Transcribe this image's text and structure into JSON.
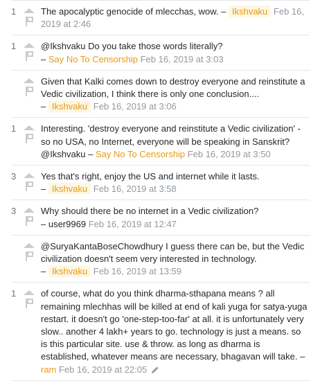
{
  "comments": [
    {
      "score": "1",
      "segments": [
        {
          "type": "text",
          "value": "The apocalyptic genocide of mlecchas, wow. – "
        },
        {
          "type": "user",
          "value": "Ikshvaku",
          "style": "owner"
        },
        {
          "type": "text",
          "value": " "
        },
        {
          "type": "date",
          "value": "Feb 16, 2019 at 2:46"
        }
      ]
    },
    {
      "score": "1",
      "segments": [
        {
          "type": "text",
          "value": "@Ikshvaku Do you take those words literally?"
        },
        {
          "type": "br"
        },
        {
          "type": "text",
          "value": "– "
        },
        {
          "type": "user",
          "value": "Say No To Censorship",
          "style": "orange"
        },
        {
          "type": "text",
          "value": " "
        },
        {
          "type": "date",
          "value": "Feb 16, 2019 at 3:03"
        }
      ]
    },
    {
      "score": "",
      "segments": [
        {
          "type": "text",
          "value": "Given that Kalki comes down to destroy everyone and reinstitute a Vedic civilization, I think there is only one conclusion...."
        },
        {
          "type": "br"
        },
        {
          "type": "text",
          "value": "– "
        },
        {
          "type": "user",
          "value": "Ikshvaku",
          "style": "owner"
        },
        {
          "type": "text",
          "value": " "
        },
        {
          "type": "date",
          "value": "Feb 16, 2019 at 3:06"
        }
      ]
    },
    {
      "score": "1",
      "segments": [
        {
          "type": "text",
          "value": "Interesting. 'destroy everyone and reinstitute a Vedic civilization' - so no USA, no Internet, everyone will be speaking in Sanskrit? @Ikshvaku – "
        },
        {
          "type": "user",
          "value": "Say No To Censorship",
          "style": "orange"
        },
        {
          "type": "text",
          "value": " "
        },
        {
          "type": "date",
          "value": "Feb 16, 2019 at 3:50"
        }
      ]
    },
    {
      "score": "3",
      "segments": [
        {
          "type": "text",
          "value": "Yes that's right, enjoy the US and internet while it lasts."
        },
        {
          "type": "br"
        },
        {
          "type": "text",
          "value": "– "
        },
        {
          "type": "user",
          "value": "Ikshvaku",
          "style": "owner"
        },
        {
          "type": "text",
          "value": " "
        },
        {
          "type": "date",
          "value": "Feb 16, 2019 at 3:58"
        }
      ]
    },
    {
      "score": "3",
      "segments": [
        {
          "type": "text",
          "value": "Why should there be no internet in a Vedic civilization?"
        },
        {
          "type": "br"
        },
        {
          "type": "text",
          "value": "– "
        },
        {
          "type": "user",
          "value": "user9969",
          "style": "plain"
        },
        {
          "type": "text",
          "value": " "
        },
        {
          "type": "date",
          "value": "Feb 16, 2019 at 12:47"
        }
      ]
    },
    {
      "score": "",
      "segments": [
        {
          "type": "text",
          "value": "@SuryaKantaBoseChowdhury I guess there can be, but the Vedic civilization doesn't seem very interested in technology."
        },
        {
          "type": "br"
        },
        {
          "type": "text",
          "value": "– "
        },
        {
          "type": "user",
          "value": "Ikshvaku",
          "style": "owner"
        },
        {
          "type": "text",
          "value": " "
        },
        {
          "type": "date",
          "value": "Feb 16, 2019 at 13:59"
        }
      ]
    },
    {
      "score": "1",
      "segments": [
        {
          "type": "text",
          "value": "of course, what do you think dharma-sthapana means ? all remaining mlechhas will be killed at end of kali yuga for satya-yuga restart. it doesn't go 'one-step-too-far' at all. it is unfortunately very slow.. another 4 lakh+ years to go. technology is just a means. so is this particular site. use & throw. as long as dharma is established, whatever means are necessary, bhagavan will take. – "
        },
        {
          "type": "user",
          "value": "ram",
          "style": "orange"
        },
        {
          "type": "text",
          "value": " "
        },
        {
          "type": "date",
          "value": "Feb 16, 2019 at 22:05"
        },
        {
          "type": "edited"
        }
      ]
    }
  ],
  "icons": {
    "upvote": "upvote-arrow-icon",
    "flag": "flag-icon",
    "edit": "pencil-edit-icon"
  },
  "colors": {
    "owner_bg": "#fdf7e2",
    "owner_text": "#e89a17",
    "date": "#9199a1",
    "score": "#6a737c",
    "icon": "#c8ccd0",
    "border": "#e4e6e8"
  }
}
